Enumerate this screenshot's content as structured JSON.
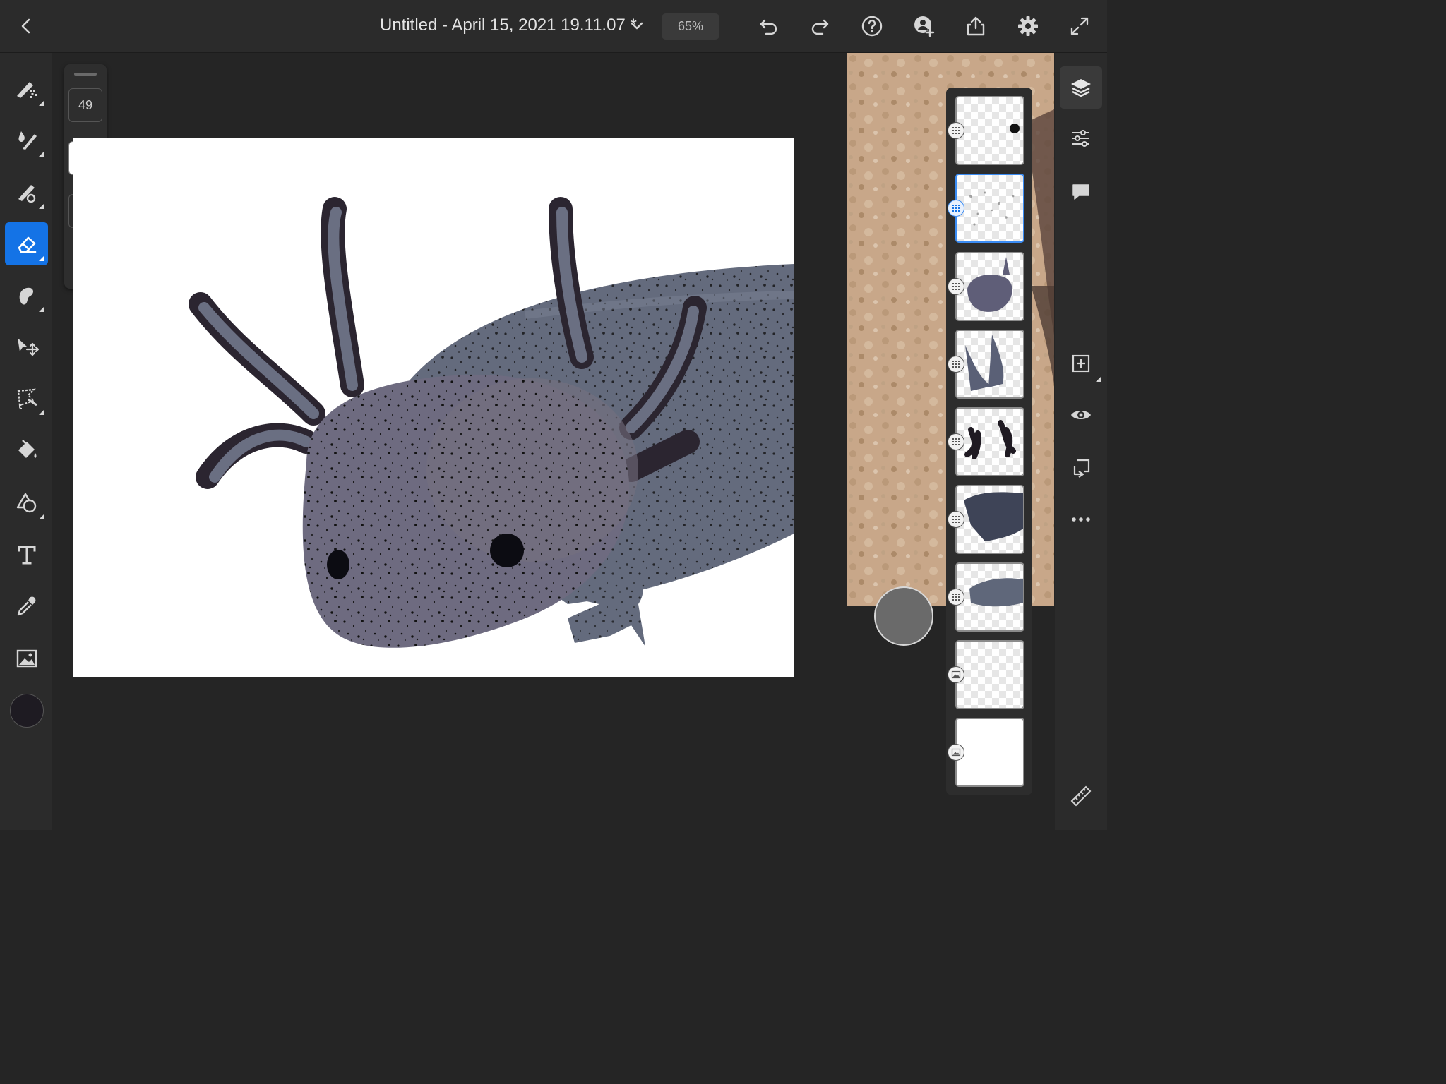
{
  "document": {
    "title": "Untitled - April 15, 2021 19.11.07 *",
    "zoom": "65%"
  },
  "brush_panel": {
    "size": "49"
  },
  "colors": {
    "accent": "#1473e6",
    "current_color": "#1e1b22",
    "canvas": "#ffffff"
  },
  "toolbar_icons": [
    "back-icon",
    "chevron-down-icon",
    "undo-icon",
    "redo-icon",
    "help-icon",
    "invite-icon",
    "share-icon",
    "gear-icon",
    "fullscreen-icon"
  ],
  "tools": [
    "pixel-brush",
    "live-brush",
    "vector-brush",
    "eraser",
    "smudge",
    "transform",
    "selection",
    "fill",
    "shape",
    "type",
    "eyedropper",
    "image"
  ],
  "active_tool": "eraser",
  "layers": {
    "count": 9,
    "selected_index": 1
  }
}
